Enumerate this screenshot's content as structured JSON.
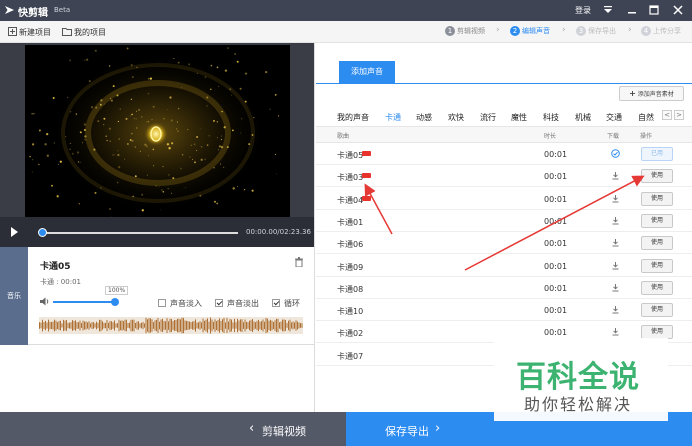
{
  "app": {
    "name": "快剪辑",
    "badge": "Beta"
  },
  "titlebar": {
    "login": "登录"
  },
  "toolbar": {
    "new_project": "新建项目",
    "my_projects": "我的项目"
  },
  "steps": [
    {
      "num": "1",
      "label": "剪辑视频"
    },
    {
      "num": "2",
      "label": "编辑声音"
    },
    {
      "num": "3",
      "label": "保存导出"
    },
    {
      "num": "4",
      "label": "上传分享"
    }
  ],
  "player": {
    "time": "00:00.00/02:23.36"
  },
  "clip": {
    "tab": "音乐",
    "name": "卡通05",
    "meta": "卡通 : 00:01",
    "volume": "100%",
    "fade_in": "声音淡入",
    "fade_out": "声音淡出",
    "loop": "循环"
  },
  "panel": {
    "tab": "添加声音",
    "add_material": "添加声音素材",
    "categories": [
      "我的声音",
      "卡通",
      "动感",
      "欢快",
      "流行",
      "魔性",
      "科技",
      "机械",
      "交通",
      "自然"
    ],
    "active_category": "卡通",
    "nav_prev": "<",
    "nav_next": ">",
    "headers": {
      "song": "歌曲",
      "duration": "时长",
      "download": "下载",
      "action": "操作"
    }
  },
  "rows": [
    {
      "name": "卡通05",
      "duration": "00:01",
      "action": "已用"
    },
    {
      "name": "卡通03",
      "duration": "00:01",
      "action": "使用"
    },
    {
      "name": "卡通04",
      "duration": "00:01",
      "action": "使用"
    },
    {
      "name": "卡通01",
      "duration": "00:01",
      "action": "使用"
    },
    {
      "name": "卡通06",
      "duration": "00:01",
      "action": "使用"
    },
    {
      "name": "卡通09",
      "duration": "00:01",
      "action": "使用"
    },
    {
      "name": "卡通08",
      "duration": "00:01",
      "action": "使用"
    },
    {
      "name": "卡通10",
      "duration": "00:01",
      "action": "使用"
    },
    {
      "name": "卡通02",
      "duration": "00:01",
      "action": "使用"
    },
    {
      "name": "卡通07",
      "duration": "",
      "action": ""
    }
  ],
  "bottom": {
    "back": "剪辑视频",
    "save": "保存导出"
  },
  "watermark": {
    "title": "百科全说",
    "subtitle": "助你轻松解决"
  },
  "colors": {
    "accent": "#2d8cf0",
    "titlebar": "#3f4454",
    "annotation_arrow": "#e53935",
    "watermark_green": "#3cb371"
  }
}
